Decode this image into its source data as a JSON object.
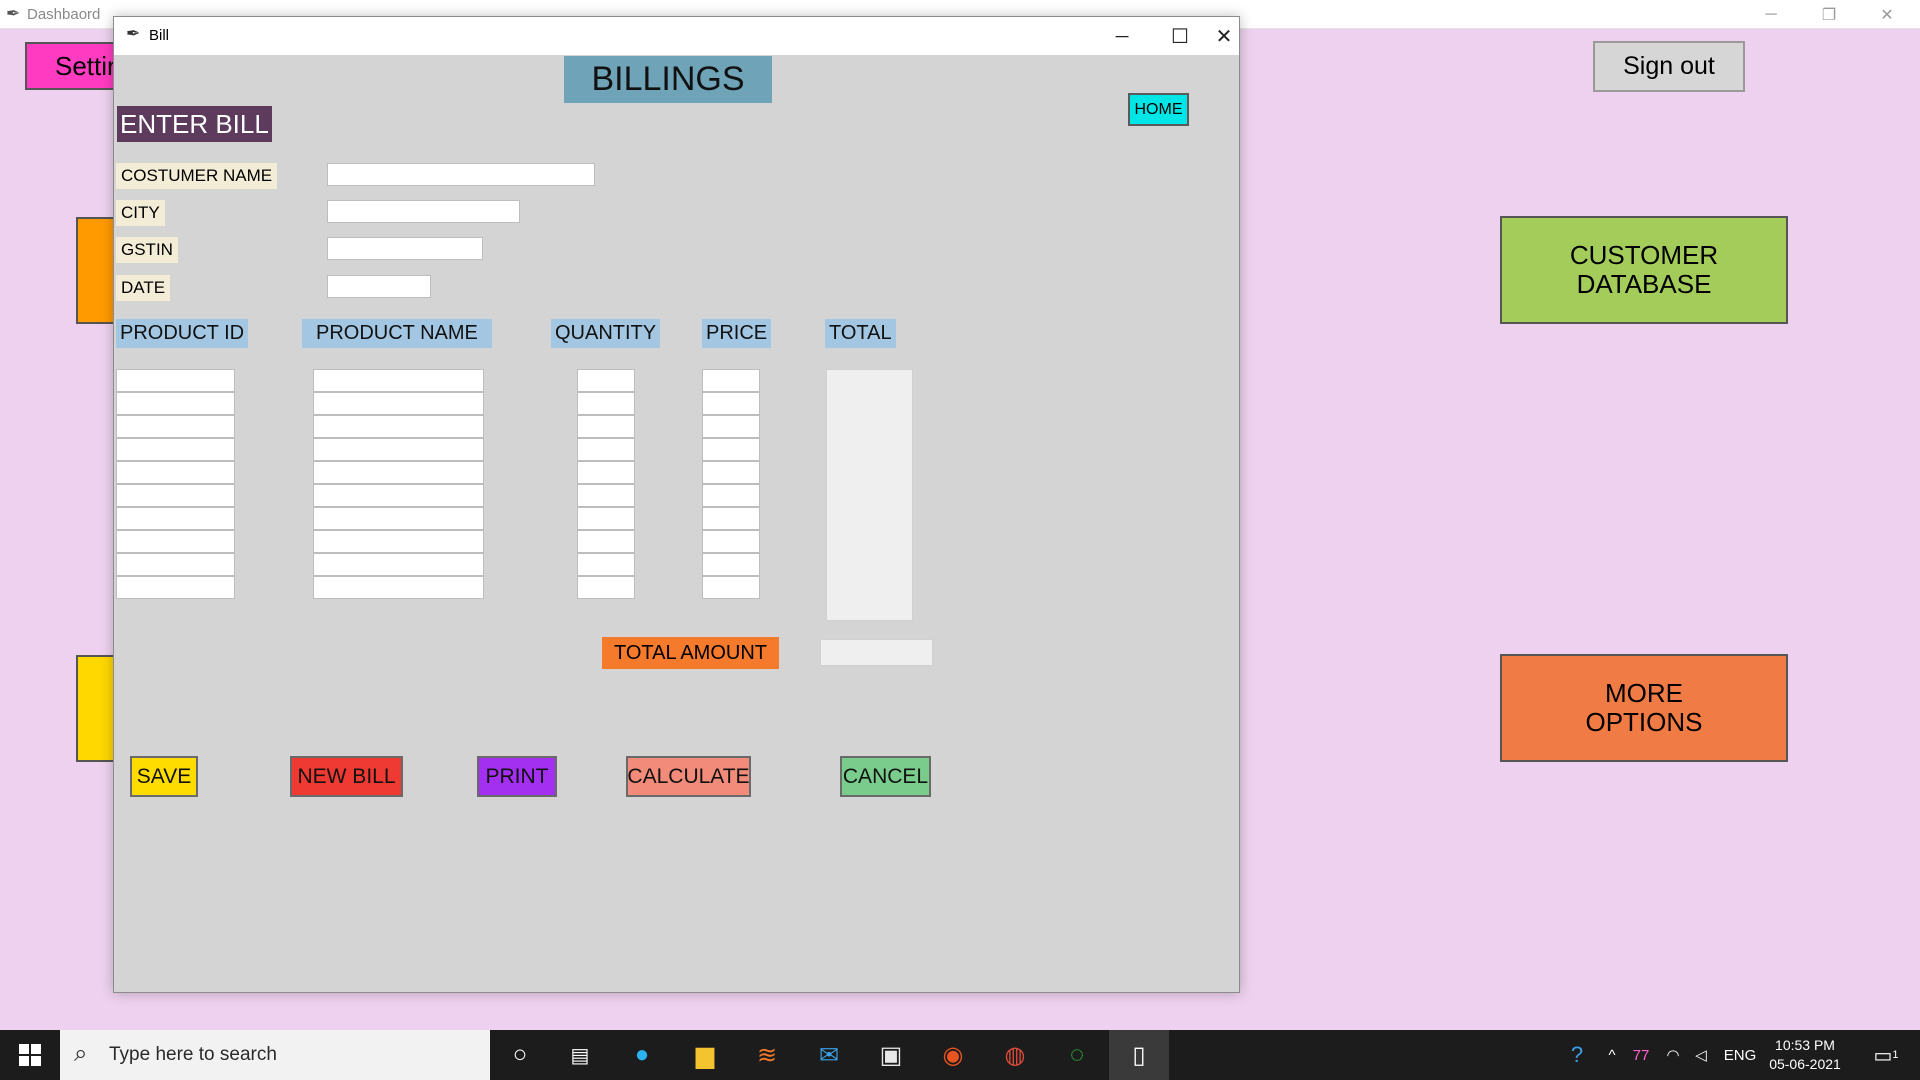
{
  "dashboard": {
    "title": "Dashbaord",
    "settings_label": "Settin",
    "signout_label": "Sign out",
    "customer_db_label": "CUSTOMER\nDATABASE",
    "more_options_label": "MORE\nOPTIONS"
  },
  "bill_window": {
    "title": "Bill",
    "heading": "BILLINGS",
    "enter_bill_label": "ENTER BILL",
    "home_label": "HOME",
    "fields": {
      "customer_name_label": "COSTUMER NAME",
      "customer_name_value": "",
      "city_label": "CITY",
      "city_value": "",
      "gstin_label": "GSTIN",
      "gstin_value": "",
      "date_label": "DATE",
      "date_value": ""
    },
    "columns": {
      "product_id": "PRODUCT ID",
      "product_name": "PRODUCT NAME",
      "quantity": "QUANTITY",
      "price": "PRICE",
      "total": "TOTAL"
    },
    "total_amount_label": "TOTAL AMOUNT",
    "total_amount_value": "",
    "buttons": {
      "save": "SAVE",
      "new_bill": "NEW BILL",
      "print": "PRINT",
      "calculate": "CALCULATE",
      "cancel": "CANCEL"
    }
  },
  "taskbar": {
    "search_placeholder": "Type here to search",
    "tray_number": "77",
    "language": "ENG",
    "time": "10:53 PM",
    "date": "05-06-2021",
    "notification_count": "1"
  },
  "colors": {
    "desktop_bg": "#edd1ee",
    "settings": "#ff3cc1",
    "customer_db": "#a3cc5a",
    "more_options": "#f07b44",
    "heading_bg": "#6fa3b7",
    "enter_bill_bg": "#5d3b5c",
    "home_bg": "#00e5e5",
    "total_amount_bg": "#f57a2b",
    "save": "#ffdc00",
    "new_bill": "#ef3a33",
    "print": "#a330f0",
    "calculate": "#f28b7a",
    "cancel": "#7acc8c"
  }
}
